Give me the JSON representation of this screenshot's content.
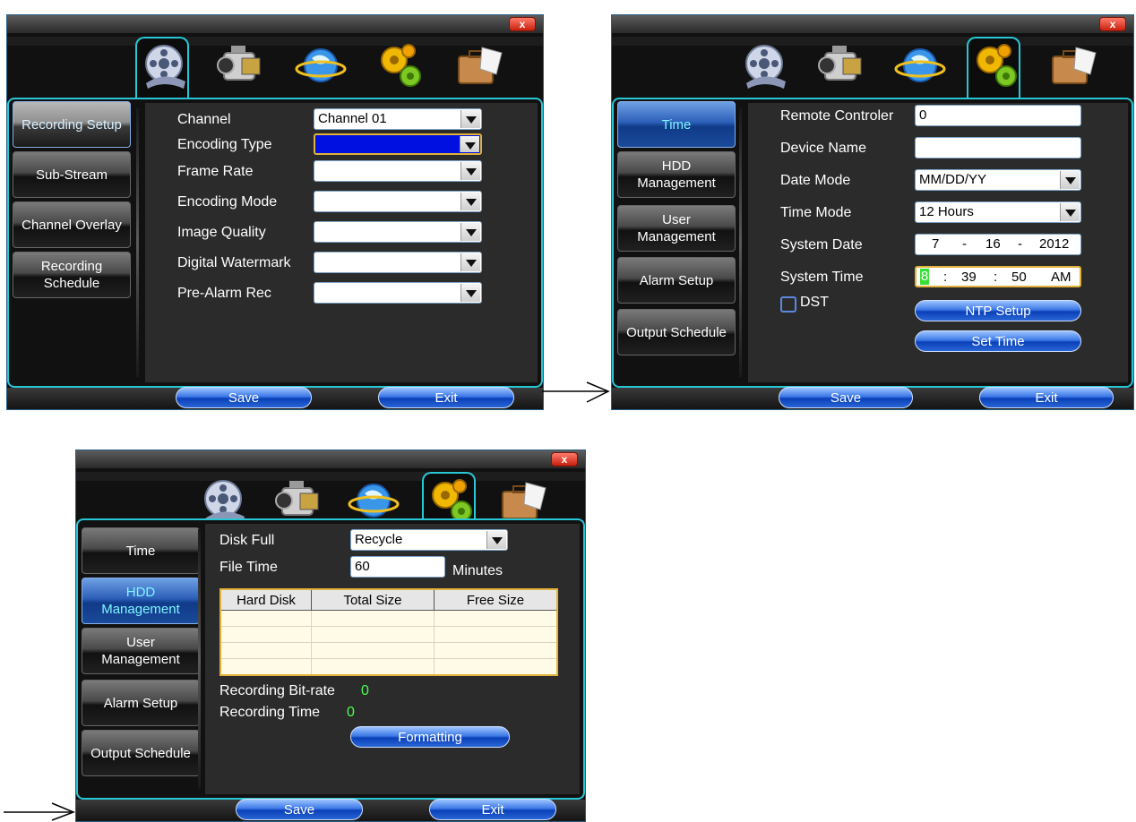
{
  "tabs_icons": [
    "film-reel-icon",
    "camcorder-icon",
    "globe-network-icon",
    "gears-icon",
    "briefcase-mail-icon"
  ],
  "close_label": "x",
  "footer": {
    "save": "Save",
    "exit": "Exit"
  },
  "recording_panel": {
    "sidebar": [
      "Recording Setup",
      "Sub-Stream",
      "Channel Overlay",
      "Recording Schedule"
    ],
    "fields": [
      {
        "label": "Channel",
        "value": "Channel 01"
      },
      {
        "label": "Encoding Type",
        "value": ""
      },
      {
        "label": "Frame Rate",
        "value": ""
      },
      {
        "label": "Encoding Mode",
        "value": ""
      },
      {
        "label": "Image Quality",
        "value": ""
      },
      {
        "label": "Digital Watermark",
        "value": ""
      },
      {
        "label": "Pre-Alarm Rec",
        "value": ""
      }
    ]
  },
  "system_panel": {
    "sidebar": [
      "Time",
      "HDD Management",
      "User Management",
      "Alarm Setup",
      "Output Schedule"
    ],
    "remote_controller_label": "Remote Controler",
    "remote_controller_value": "0",
    "device_name_label": "Device Name",
    "device_name_value": "",
    "date_mode_label": "Date Mode",
    "date_mode_value": "MM/DD/YY",
    "time_mode_label": "Time Mode",
    "time_mode_value": "12 Hours",
    "system_date_label": "System Date",
    "system_date": {
      "month": "7",
      "day": "16",
      "year": "2012",
      "sep": "-"
    },
    "system_time_label": "System Time",
    "system_time": {
      "hour": "8",
      "minute": "39",
      "second": "50",
      "ampm": "AM",
      "sep": ":"
    },
    "dst_label": "DST",
    "ntp_button": "NTP Setup",
    "set_time_button": "Set Time"
  },
  "hdd_panel": {
    "sidebar": [
      "Time",
      "HDD Management",
      "User Management",
      "Alarm Setup",
      "Output Schedule"
    ],
    "disk_full_label": "Disk Full",
    "disk_full_value": "Recycle",
    "file_time_label": "File Time",
    "file_time_value": "60",
    "file_time_unit": "Minutes",
    "table_headers": [
      "Hard Disk",
      "Total Size",
      "Free Size"
    ],
    "bitrate_label": "Recording Bit-rate",
    "bitrate_value": "0",
    "rectime_label": "Recording Time",
    "rectime_value": "0",
    "formatting_button": "Formatting"
  }
}
